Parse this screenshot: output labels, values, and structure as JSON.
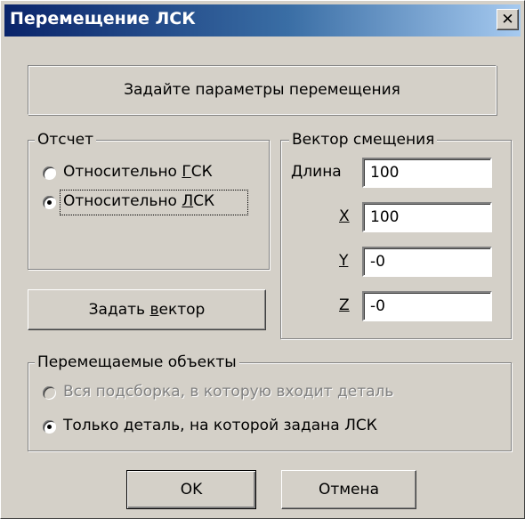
{
  "window": {
    "title": "Перемещение ЛСК",
    "close_glyph": "✕"
  },
  "banner": "Задайте параметры перемещения",
  "reference_group": {
    "legend": "Отсчет",
    "options": [
      {
        "prefix": "Относительно ",
        "mnemonic": "Г",
        "suffix": "СК",
        "selected": false
      },
      {
        "prefix": "Относительно ",
        "mnemonic": "Л",
        "suffix": "СК",
        "selected": true
      }
    ]
  },
  "set_vector_button": {
    "prefix": "Задать ",
    "mnemonic": "в",
    "suffix": "ектор"
  },
  "vector_group": {
    "legend": "Вектор смещения",
    "length_label": "Длина",
    "length_value": "100",
    "x_label": "X",
    "x_value": "100",
    "y_label": "Y",
    "y_value": "-0",
    "z_label": "Z",
    "z_value": "-0"
  },
  "objects_group": {
    "legend": "Перемещаемые объекты",
    "options": [
      {
        "label": "Вся подсборка, в которую входит деталь",
        "selected": false,
        "enabled": false
      },
      {
        "label": "Только деталь, на которой задана ЛСК",
        "selected": true,
        "enabled": true
      }
    ]
  },
  "buttons": {
    "ok": "OK",
    "cancel": "Отмена"
  }
}
